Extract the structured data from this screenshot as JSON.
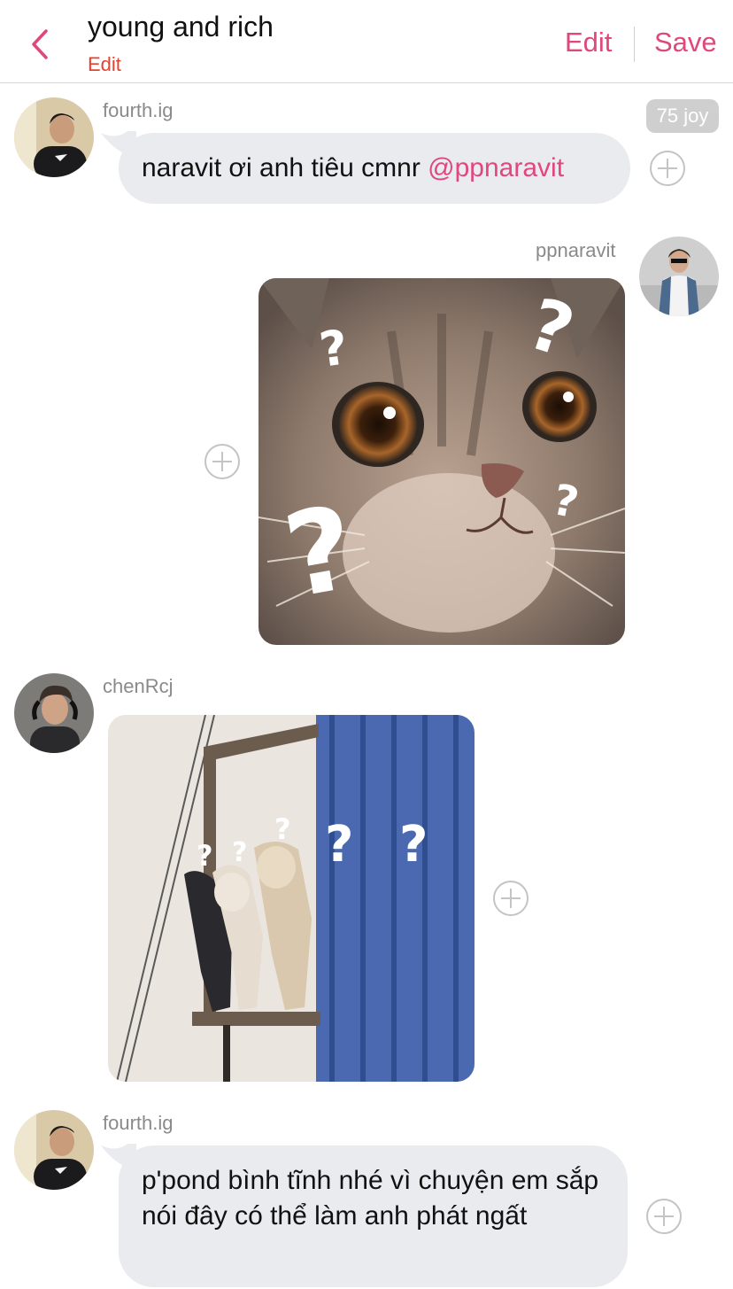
{
  "header": {
    "title": "young and rich",
    "subtitle": "Edit",
    "edit_label": "Edit",
    "save_label": "Save"
  },
  "messages": [
    {
      "username": "fourth.ig",
      "text": "naravit ơi anh tiêu cmnr",
      "mention": "@ppnaravit",
      "badge": "75 joy"
    },
    {
      "username": "ppnaravit",
      "image": "cat-question-meme"
    },
    {
      "username": "chenRcj",
      "image": "dogs-question-meme",
      "marks": "? ? ?"
    },
    {
      "username": "fourth.ig",
      "text": "p'pond bình tĩnh nhé vì chuyện em sắp nói đây có thể làm anh phát ngất"
    }
  ],
  "colors": {
    "accent": "#e0477a",
    "subtitle": "#e8402e",
    "bubble": "#e9ebee",
    "username": "#8a8a8a"
  }
}
